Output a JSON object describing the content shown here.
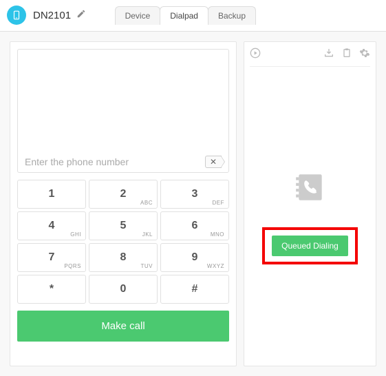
{
  "header": {
    "device_name": "DN2101",
    "tabs": [
      {
        "label": "Device",
        "active": false
      },
      {
        "label": "Dialpad",
        "active": true
      },
      {
        "label": "Backup",
        "active": false
      }
    ]
  },
  "dialpad": {
    "phone_placeholder": "Enter the phone number",
    "phone_value": "",
    "clear_label": "✕",
    "keys": [
      {
        "digit": "1",
        "letters": ""
      },
      {
        "digit": "2",
        "letters": "ABC"
      },
      {
        "digit": "3",
        "letters": "DEF"
      },
      {
        "digit": "4",
        "letters": "GHI"
      },
      {
        "digit": "5",
        "letters": "JKL"
      },
      {
        "digit": "6",
        "letters": "MNO"
      },
      {
        "digit": "7",
        "letters": "PQRS"
      },
      {
        "digit": "8",
        "letters": "TUV"
      },
      {
        "digit": "9",
        "letters": "WXYZ"
      },
      {
        "digit": "*",
        "letters": ""
      },
      {
        "digit": "0",
        "letters": ""
      },
      {
        "digit": "#",
        "letters": ""
      }
    ],
    "make_call_label": "Make call"
  },
  "side": {
    "queued_label": "Queued Dialing"
  },
  "colors": {
    "accent_green": "#4bc970",
    "accent_blue": "#2dc3e8",
    "highlight_red": "#f40000"
  }
}
